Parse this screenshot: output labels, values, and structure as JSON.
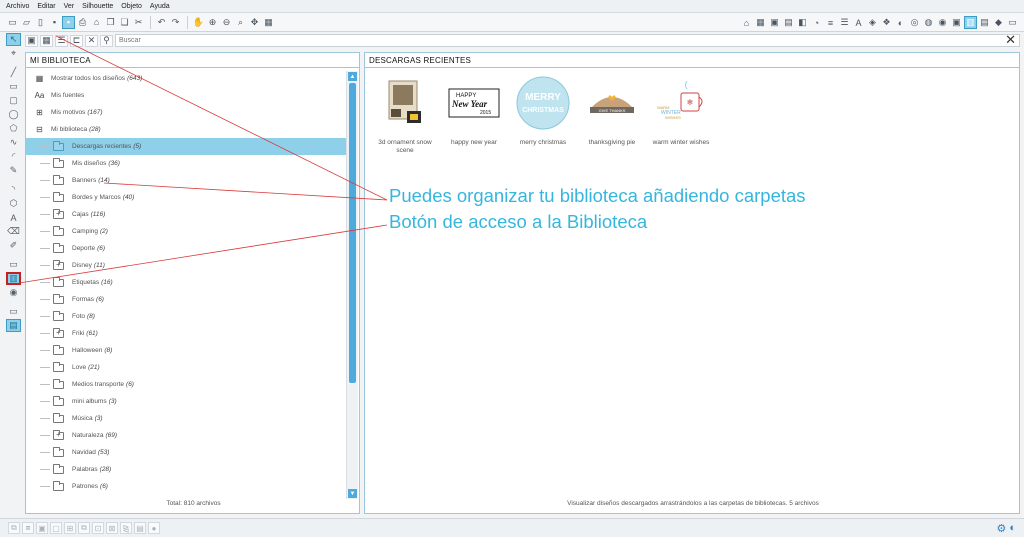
{
  "menu": [
    "Archivo",
    "Editar",
    "Ver",
    "Silhouette",
    "Objeto",
    "Ayuda"
  ],
  "search": {
    "placeholder": "Buscar",
    "close": "✕"
  },
  "library": {
    "title": "MI BIBLIOTECA",
    "top_items": [
      {
        "label": "Mostrar todos los diseños",
        "count": "(643)",
        "icon": "grid-icon"
      },
      {
        "label": "Mis fuentes",
        "count": "",
        "icon": "font-icon"
      },
      {
        "label": "Mis motivos",
        "count": "(167)",
        "icon": "plus-icon"
      },
      {
        "label": "Mi biblioteca",
        "count": "(28)",
        "icon": "minus-icon"
      }
    ],
    "folders": [
      {
        "label": "Descargas recientes",
        "count": "(5)",
        "selected": true,
        "plus": false
      },
      {
        "label": "Mis diseños",
        "count": "(36)",
        "selected": false,
        "plus": false
      },
      {
        "label": "Banners",
        "count": "(14)",
        "selected": false,
        "plus": false
      },
      {
        "label": "Bordes y Marcos",
        "count": "(40)",
        "selected": false,
        "plus": false
      },
      {
        "label": "Cajas",
        "count": "(116)",
        "selected": false,
        "plus": true
      },
      {
        "label": "Camping",
        "count": "(2)",
        "selected": false,
        "plus": false
      },
      {
        "label": "Deporte",
        "count": "(6)",
        "selected": false,
        "plus": false
      },
      {
        "label": "Disney",
        "count": "(11)",
        "selected": false,
        "plus": true
      },
      {
        "label": "Etiquetas",
        "count": "(16)",
        "selected": false,
        "plus": false
      },
      {
        "label": "Formas",
        "count": "(6)",
        "selected": false,
        "plus": false
      },
      {
        "label": "Foto",
        "count": "(8)",
        "selected": false,
        "plus": false
      },
      {
        "label": "Friki",
        "count": "(61)",
        "selected": false,
        "plus": true
      },
      {
        "label": "Halloween",
        "count": "(8)",
        "selected": false,
        "plus": false
      },
      {
        "label": "Love",
        "count": "(21)",
        "selected": false,
        "plus": false
      },
      {
        "label": "Medios transporte",
        "count": "(6)",
        "selected": false,
        "plus": false
      },
      {
        "label": "mini albums",
        "count": "(3)",
        "selected": false,
        "plus": false
      },
      {
        "label": "Música",
        "count": "(3)",
        "selected": false,
        "plus": false
      },
      {
        "label": "Naturaleza",
        "count": "(69)",
        "selected": false,
        "plus": true
      },
      {
        "label": "Navidad",
        "count": "(53)",
        "selected": false,
        "plus": false
      },
      {
        "label": "Palabras",
        "count": "(28)",
        "selected": false,
        "plus": false
      },
      {
        "label": "Patrones",
        "count": "(6)",
        "selected": false,
        "plus": false
      }
    ],
    "footer": "Total: 810 archivos"
  },
  "recent": {
    "title": "DESCARGAS RECIENTES",
    "items": [
      {
        "label": "3d ornament snow scene",
        "kind": "ornament"
      },
      {
        "label": "happy new year",
        "kind": "newyear",
        "art_lines": [
          "HAPPY",
          "New Year",
          "2015"
        ]
      },
      {
        "label": "merry christmas",
        "kind": "christmas",
        "art_lines": [
          "MERRY",
          "CHRISTMAS"
        ]
      },
      {
        "label": "thanksgiving pie",
        "kind": "pie",
        "art_lines": [
          "GIVE THANKS"
        ]
      },
      {
        "label": "warm winter wishes",
        "kind": "mug",
        "art_lines": [
          "WARM",
          "WINTER",
          "WISHES"
        ]
      }
    ],
    "footer": "Visualizar diseños descargados arrastrándolos a las carpetas de bibliotecas. 5 archivos"
  },
  "annotations": {
    "folders_note": "Puedes organizar tu biblioteca añadiendo carpetas",
    "access_note": "Botón de acceso a la Biblioteca"
  },
  "colors": {
    "accent": "#8ecfea",
    "annotation": "#36b6de",
    "line": "#d93a3a",
    "highlight_box": "#c62020"
  }
}
